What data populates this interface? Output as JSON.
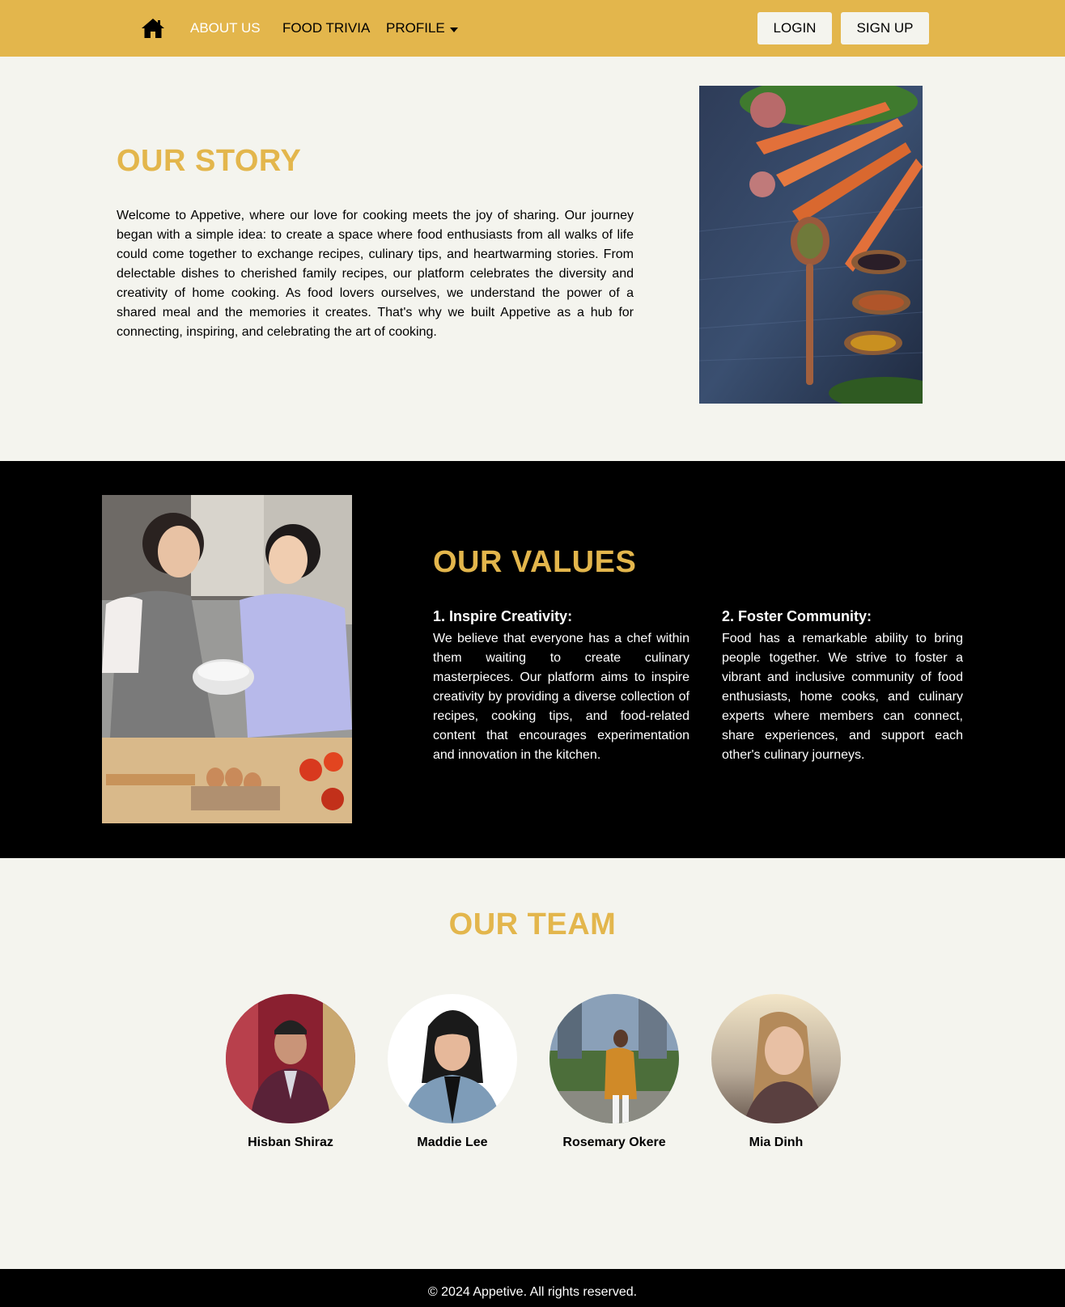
{
  "nav": {
    "home_icon": "home-icon",
    "about": "ABOUT US",
    "trivia": "FOOD TRIVIA",
    "profile": "PROFILE",
    "login": "LOGIN",
    "signup": "SIGN UP"
  },
  "story": {
    "title": "OUR STORY",
    "text": "Welcome to Appetive, where our love for cooking meets the joy of sharing. Our journey began with a simple idea: to create a space where food enthusiasts from all walks of life could come together to exchange recipes, culinary tips, and heartwarming stories. From delectable dishes to cherished family recipes, our platform celebrates the diversity and creativity of home cooking. As food lovers ourselves, we understand the power of a shared meal and the memories it creates. That's why we built Appetive as a hub for connecting, inspiring, and celebrating the art of cooking."
  },
  "values": {
    "title": "OUR VALUES",
    "items": [
      {
        "heading": "1. Inspire Creativity:",
        "text": "We believe that everyone has a chef within them waiting to create culinary masterpieces. Our platform aims to inspire creativity by providing a diverse collection of recipes, cooking tips, and food-related content that encourages experimentation and innovation in the kitchen."
      },
      {
        "heading": "2. Foster Community:",
        "text": "Food has a remarkable ability to bring people together. We strive to foster a vibrant and inclusive community of food enthusiasts, home cooks, and culinary experts where members can connect, share experiences, and support each other's culinary journeys."
      }
    ]
  },
  "team": {
    "title": "OUR TEAM",
    "members": [
      {
        "name": "Hisban Shiraz"
      },
      {
        "name": "Maddie Lee"
      },
      {
        "name": "Rosemary Okere"
      },
      {
        "name": "Mia Dinh"
      }
    ]
  },
  "footer": {
    "text": "© 2024 Appetive. All rights reserved."
  },
  "colors": {
    "accent": "#e3b64c",
    "page_bg": "#f4f4ee",
    "dark_bg": "#000000"
  }
}
